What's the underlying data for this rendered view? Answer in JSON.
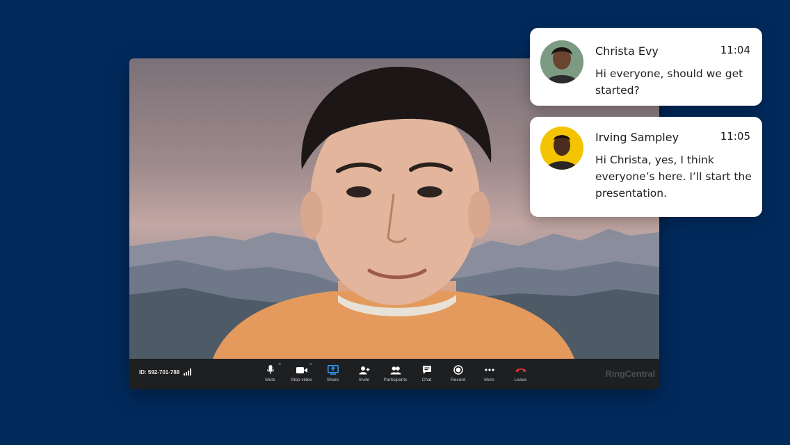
{
  "meeting": {
    "id_label": "ID: 592-701-788",
    "brand": "RingCentral"
  },
  "toolbar": {
    "buttons": [
      {
        "label": "Mute",
        "icon": "microphone-icon",
        "has_caret": true
      },
      {
        "label": "Stop video",
        "icon": "video-camera-icon",
        "has_caret": true
      },
      {
        "label": "Share",
        "icon": "share-screen-icon",
        "has_caret": false
      },
      {
        "label": "Invite",
        "icon": "invite-icon",
        "has_caret": false
      },
      {
        "label": "Participants",
        "icon": "participants-icon",
        "has_caret": false
      },
      {
        "label": "Chat",
        "icon": "chat-icon",
        "has_caret": false
      },
      {
        "label": "Record",
        "icon": "record-icon",
        "has_caret": false
      },
      {
        "label": "More",
        "icon": "more-icon",
        "has_caret": false
      },
      {
        "label": "Leave",
        "icon": "leave-phone-icon",
        "has_caret": false
      }
    ]
  },
  "chat": {
    "messages": [
      {
        "name": "Christa Evy",
        "time": "11:04",
        "text": "Hi everyone, should we get started?",
        "avatar_bg": "#6e8a72"
      },
      {
        "name": "Irving Sampley",
        "time": "11:05",
        "text": "Hi Christa, yes, I think everyone’s here. I’ll start the presentation.",
        "avatar_bg": "#f5c400"
      }
    ]
  },
  "colors": {
    "background": "#002a5c",
    "toolbar": "#1e1f21",
    "share_accent": "#2f9bff",
    "leave": "#e0323a"
  }
}
